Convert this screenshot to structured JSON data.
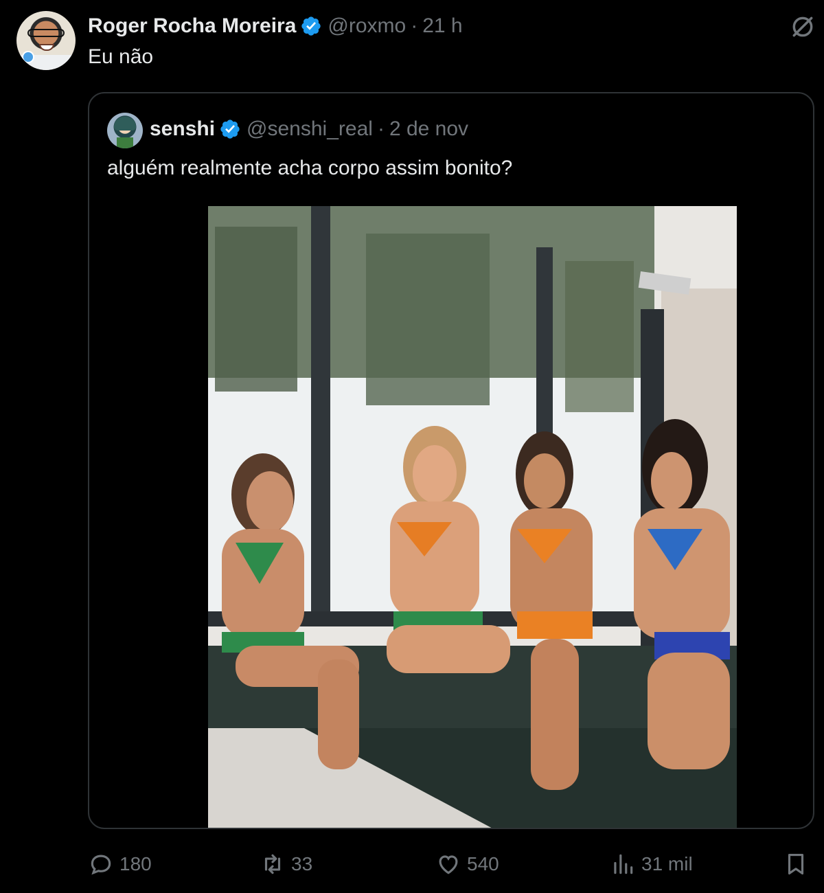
{
  "tweet": {
    "author_name": "Roger Rocha Moreira",
    "author_handle": "@roxmo",
    "separator": "·",
    "time": "21 h",
    "text": "Eu não"
  },
  "quote": {
    "author_name": "senshi",
    "author_handle": "@senshi_real",
    "separator": "·",
    "date": "2 de nov",
    "text": "alguém realmente acha corpo assim bonito?"
  },
  "actions": {
    "replies": "180",
    "reposts": "33",
    "likes": "540",
    "views": "31 mil"
  },
  "icons": {
    "verified": "verified-badge-icon",
    "grok": "grok-icon",
    "reply": "reply-icon",
    "repost": "repost-icon",
    "like": "heart-icon",
    "views": "views-icon",
    "bookmark": "bookmark-icon"
  },
  "colors": {
    "background": "#000000",
    "text": "#e7e9ea",
    "muted": "#71767b",
    "verified": "#1d9bf0",
    "border": "#2f3336"
  }
}
